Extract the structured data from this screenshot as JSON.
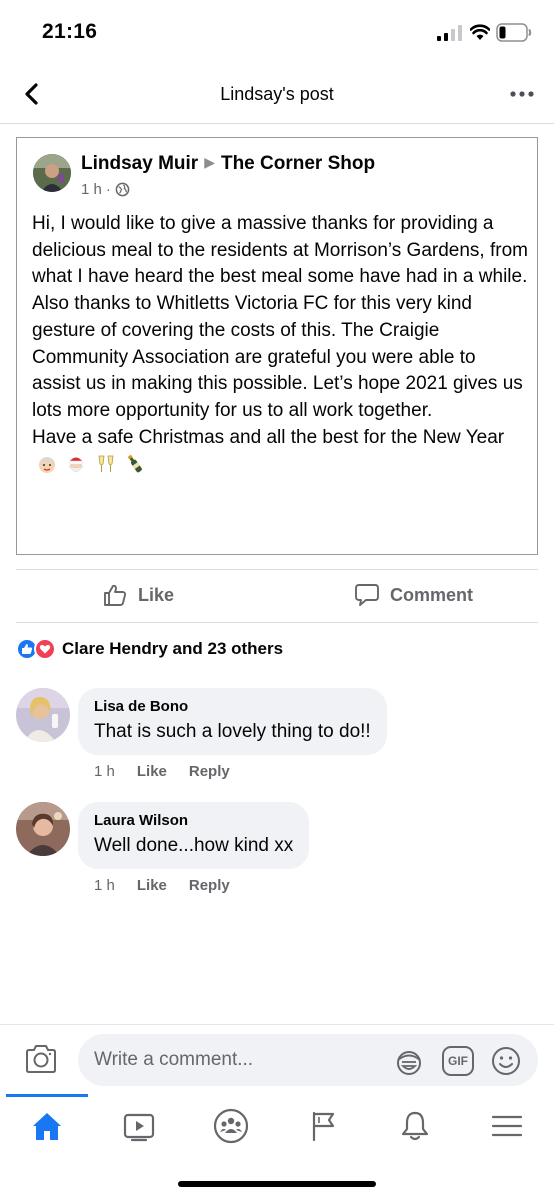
{
  "status_bar": {
    "time": "21:16"
  },
  "header": {
    "title": "Lindsay's post"
  },
  "post": {
    "author": "Lindsay Muir",
    "target": "The Corner Shop",
    "time": "1 h",
    "paragraphs": [
      "Hi, I would like to give a massive thanks for providing a delicious meal to the residents at Morrison’s Gardens, from what I have heard the best meal some have had in a while.",
      "Also thanks to Whitletts Victoria FC for this very kind gesture of covering the costs of this. The Craigie Community Association are grateful you were able to assist us in making this possible. Let’s hope 2021 gives us lots more opportunity for us to all work together.",
      "Have a safe Christmas and all the best for the New Year"
    ],
    "emojis": [
      "mrs-claus-emoji",
      "santa-emoji",
      "clinking-glasses-emoji",
      "champagne-emoji"
    ]
  },
  "actions": {
    "like_label": "Like",
    "comment_label": "Comment"
  },
  "reactions": {
    "text": "Clare Hendry and 23 others"
  },
  "comments": [
    {
      "name": "Lisa de Bono",
      "text": "That is such a lovely thing to do!!",
      "time": "1 h",
      "like": "Like",
      "reply": "Reply"
    },
    {
      "name": "Laura Wilson",
      "text": "Well done...how kind xx",
      "time": "1 h",
      "like": "Like",
      "reply": "Reply"
    }
  ],
  "composer": {
    "placeholder": "Write a comment...",
    "gif_label": "GIF"
  },
  "nav": {
    "items": [
      "home-icon",
      "video-icon",
      "groups-icon",
      "pages-flag-icon",
      "notifications-bell-icon",
      "menu-icon"
    ]
  },
  "colors": {
    "accent": "#1877f2",
    "love": "#f33e58",
    "secondary_text": "#65676b",
    "bubble": "#f0f2f5"
  }
}
